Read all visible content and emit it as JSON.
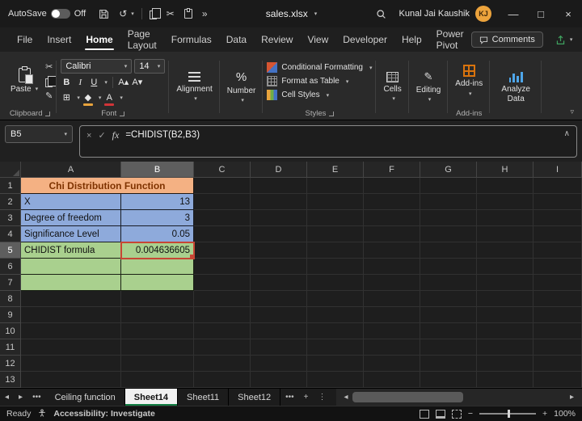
{
  "colors": {
    "accent_green": "#107C41",
    "title_fill": "#F4B183",
    "title_text": "#7F3300",
    "blue_fill": "#8EAADB",
    "green_fill": "#A9D08E",
    "active_cell_border": "#C74634",
    "avatar_bg": "#ECA33C"
  },
  "title_bar": {
    "autosave_label": "AutoSave",
    "autosave_state": "Off",
    "filename": "sales.xlsx",
    "user_name": "Kunal Jai Kaushik",
    "user_initials": "KJ"
  },
  "menu": {
    "tabs": [
      "File",
      "Insert",
      "Home",
      "Page Layout",
      "Formulas",
      "Data",
      "Review",
      "View",
      "Developer",
      "Help",
      "Power Pivot"
    ],
    "active": "Home",
    "comments_label": "Comments"
  },
  "ribbon": {
    "clipboard": {
      "paste": "Paste",
      "label": "Clipboard"
    },
    "font": {
      "name": "Calibri",
      "size": "14",
      "bold": "B",
      "italic": "I",
      "underline": "U",
      "label": "Font"
    },
    "alignment_label": "Alignment",
    "number_label": "Number",
    "styles": {
      "conditional_formatting": "Conditional Formatting",
      "format_as_table": "Format as Table",
      "cell_styles": "Cell Styles",
      "label": "Styles"
    },
    "cells_label": "Cells",
    "editing_label": "Editing",
    "addins_button": "Add-ins",
    "addins_label": "Add-ins",
    "analyze_data": "Analyze Data"
  },
  "formula_bar": {
    "name_box": "B5",
    "fx_label": "fx",
    "formula": "=CHIDIST(B2,B3)"
  },
  "grid": {
    "col_headers": [
      "A",
      "B",
      "C",
      "D",
      "E",
      "F",
      "G",
      "H",
      "I"
    ],
    "row_count": 13,
    "selected_col": "B",
    "selected_row": 5,
    "active_cell": "B5",
    "merged_title": {
      "row": 1,
      "text": "Chi Distribution Function"
    },
    "data_rows": [
      {
        "row": 2,
        "label": "X",
        "value": "13",
        "fill": "blue"
      },
      {
        "row": 3,
        "label": "Degree of freedom",
        "value": "3",
        "fill": "blue"
      },
      {
        "row": 4,
        "label": "Significance Level",
        "value": "0.05",
        "fill": "blue"
      },
      {
        "row": 5,
        "label": "CHIDIST formula",
        "value": "0.004636605",
        "fill": "green",
        "active": true
      },
      {
        "row": 6,
        "label": "",
        "value": "",
        "fill": "green"
      },
      {
        "row": 7,
        "label": "",
        "value": "",
        "fill": "green"
      }
    ]
  },
  "sheet_tabs": {
    "tabs": [
      "Ceiling function",
      "Sheet14",
      "Sheet11",
      "Sheet12"
    ],
    "active": "Sheet14"
  },
  "status_bar": {
    "ready": "Ready",
    "accessibility": "Accessibility: Investigate",
    "zoom": "100%"
  }
}
